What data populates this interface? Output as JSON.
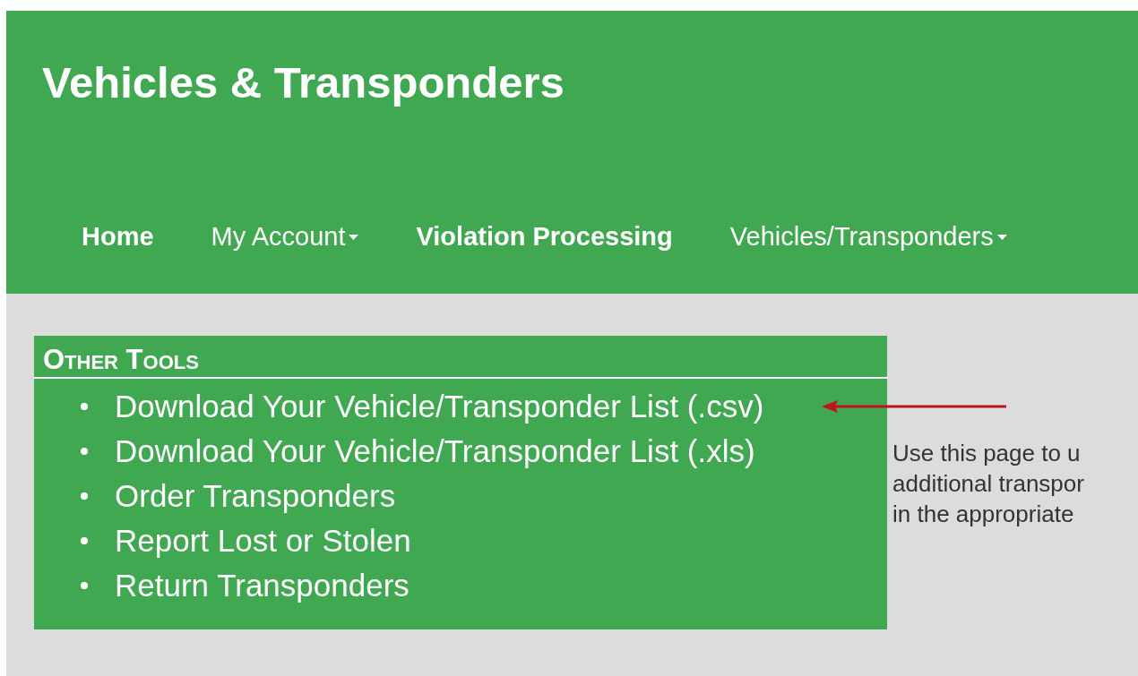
{
  "header": {
    "title": "Vehicles & Transponders"
  },
  "nav": [
    {
      "label": "Home",
      "kind": "link"
    },
    {
      "label": "My Account",
      "kind": "dropdown"
    },
    {
      "label": "Violation Processing",
      "kind": "link"
    },
    {
      "label": "Vehicles/Transponders",
      "kind": "dropdown"
    }
  ],
  "other_tools": {
    "title": "Other Tools",
    "items": [
      {
        "label": "Download Your Vehicle/Transponder List (.csv)"
      },
      {
        "label": "Download Your Vehicle/Transponder List (.xls)"
      },
      {
        "label": "Order Transponders"
      },
      {
        "label": "Report Lost or Stolen"
      },
      {
        "label": "Return Transponders"
      }
    ]
  },
  "intro_lines": [
    "Use this page to u",
    "additional transpor",
    "in the appropriate"
  ]
}
